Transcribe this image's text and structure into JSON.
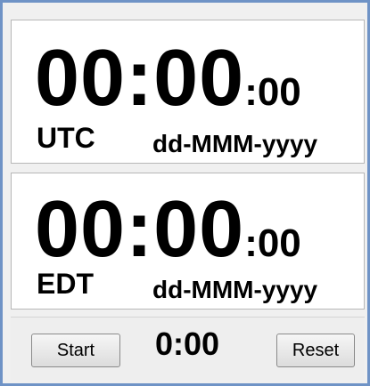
{
  "utc_clock": {
    "hours_minutes": "00:00",
    "seconds": ":00",
    "zone": "UTC",
    "date": "dd-MMM-yyyy"
  },
  "local_clock": {
    "hours_minutes": "00:00",
    "seconds": ":00",
    "zone": "EDT",
    "date": "dd-MMM-yyyy"
  },
  "stopwatch": {
    "start_label": "Start",
    "elapsed": "0:00",
    "reset_label": "Reset"
  }
}
